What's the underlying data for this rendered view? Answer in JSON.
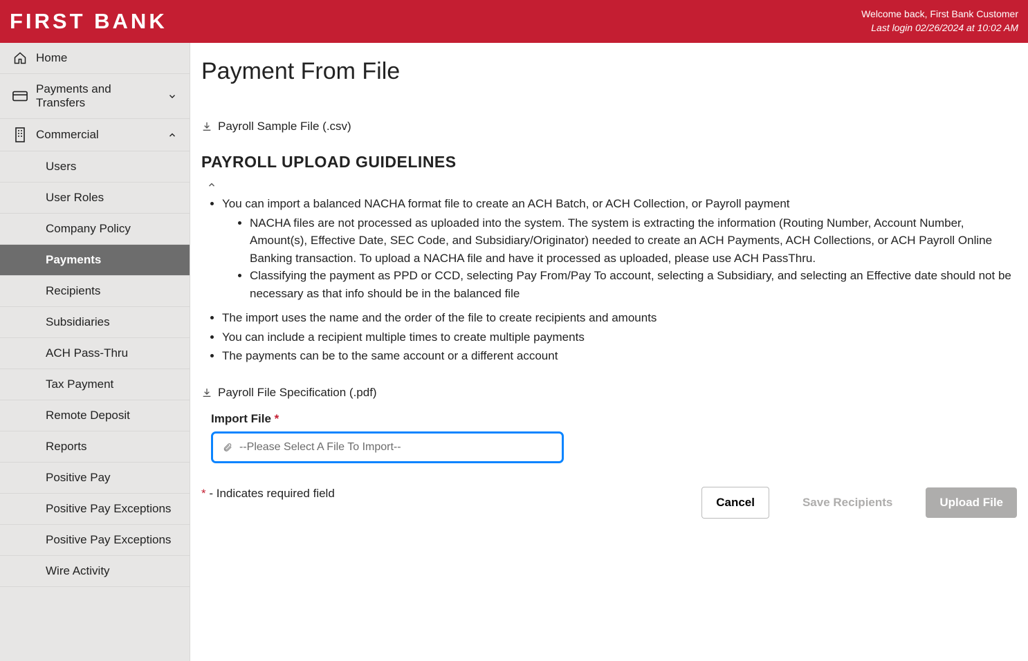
{
  "header": {
    "logo": "FIRST BANK",
    "welcome": "Welcome back, First Bank Customer",
    "last_login": "Last login 02/26/2024 at 10:02 AM"
  },
  "sidebar": {
    "home": "Home",
    "payments_transfers": "Payments and Transfers",
    "commercial": "Commercial",
    "sub": {
      "users": "Users",
      "user_roles": "User Roles",
      "company_policy": "Company Policy",
      "payments": "Payments",
      "recipients": "Recipients",
      "subsidiaries": "Subsidiaries",
      "ach_passthru": "ACH Pass-Thru",
      "tax_payment": "Tax Payment",
      "remote_deposit": "Remote Deposit",
      "reports": "Reports",
      "positive_pay": "Positive Pay",
      "ppe1": "Positive Pay Exceptions",
      "ppe2": "Positive Pay Exceptions",
      "wire_activity": "Wire Activity"
    }
  },
  "main": {
    "title": "Payment From File",
    "sample_link": "Payroll Sample File (.csv)",
    "guidelines_heading": "PAYROLL UPLOAD GUIDELINES",
    "g1": "You can import a balanced NACHA format file to create an ACH Batch, or ACH Collection, or Payroll payment",
    "g1a": "NACHA files are not processed as uploaded into the system. The system is extracting the information (Routing Number, Account Number, Amount(s), Effective Date, SEC Code, and Subsidiary/Originator) needed to create an ACH Payments, ACH Collections, or ACH Payroll Online Banking transaction. To upload a NACHA file and have it processed as uploaded, please use ACH PassThru.",
    "g1b": "Classifying the payment as PPD or CCD, selecting Pay From/Pay To account, selecting a Subsidiary, and selecting an Effective date should not be necessary as that info should be in the balanced file",
    "g2": "The import uses the name and the order of the file to create recipients and amounts",
    "g3": "You can include a recipient multiple times to create multiple payments",
    "g4": "The payments can be to the same account or a different account",
    "spec_link": "Payroll File Specification (.pdf)",
    "import_label": "Import File",
    "import_placeholder": "--Please Select A File To Import--",
    "required_note": " - Indicates required field",
    "btn_cancel": "Cancel",
    "btn_save": "Save Recipients",
    "btn_upload": "Upload File"
  }
}
